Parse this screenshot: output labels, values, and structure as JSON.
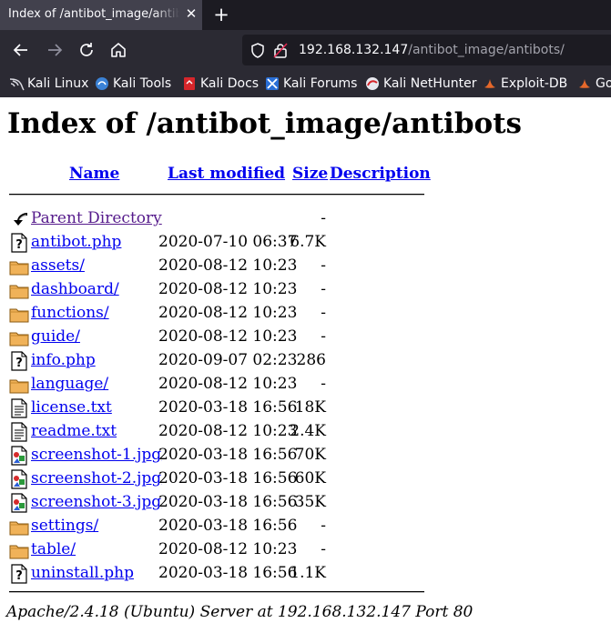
{
  "browser": {
    "tab_title": "Index of /antibot_image/antibots/",
    "close_glyph": "✕",
    "new_tab_glyph": "+",
    "url_host": "192.168.132.147",
    "url_path": "/antibot_image/antibots/"
  },
  "bookmarks": [
    {
      "label": "Kali Linux",
      "icon": "kali-dragon-icon"
    },
    {
      "label": "Kali Tools",
      "icon": "kali-tools-icon"
    },
    {
      "label": "Kali Docs",
      "icon": "kali-docs-icon"
    },
    {
      "label": "Kali Forums",
      "icon": "kali-forums-icon"
    },
    {
      "label": "Kali NetHunter",
      "icon": "kali-nethunter-icon"
    },
    {
      "label": "Exploit-DB",
      "icon": "exploit-db-icon"
    },
    {
      "label": "Go",
      "icon": "ghdb-icon"
    }
  ],
  "page": {
    "title": "Index of /antibot_image/antibots",
    "columns": {
      "name": "Name",
      "last_modified": "Last modified",
      "size": "Size",
      "description": "Description"
    },
    "entries": [
      {
        "name": "Parent Directory",
        "modified": "",
        "size": "-",
        "icon": "back-icon",
        "visited": true
      },
      {
        "name": "antibot.php",
        "modified": "2020-07-10 06:37",
        "size": "6.7K",
        "icon": "unknown-file-icon"
      },
      {
        "name": "assets/",
        "modified": "2020-08-12 10:23",
        "size": "-",
        "icon": "folder-icon"
      },
      {
        "name": "dashboard/",
        "modified": "2020-08-12 10:23",
        "size": "-",
        "icon": "folder-icon"
      },
      {
        "name": "functions/",
        "modified": "2020-08-12 10:23",
        "size": "-",
        "icon": "folder-icon"
      },
      {
        "name": "guide/",
        "modified": "2020-08-12 10:23",
        "size": "-",
        "icon": "folder-icon"
      },
      {
        "name": "info.php",
        "modified": "2020-09-07 02:23",
        "size": "286",
        "icon": "unknown-file-icon"
      },
      {
        "name": "language/",
        "modified": "2020-08-12 10:23",
        "size": "-",
        "icon": "folder-icon"
      },
      {
        "name": "license.txt",
        "modified": "2020-03-18 16:56",
        "size": "18K",
        "icon": "text-file-icon"
      },
      {
        "name": "readme.txt",
        "modified": "2020-08-12 10:23",
        "size": "2.4K",
        "icon": "text-file-icon"
      },
      {
        "name": "screenshot-1.jpg",
        "modified": "2020-03-18 16:56",
        "size": "70K",
        "icon": "image-file-icon"
      },
      {
        "name": "screenshot-2.jpg",
        "modified": "2020-03-18 16:56",
        "size": "60K",
        "icon": "image-file-icon"
      },
      {
        "name": "screenshot-3.jpg",
        "modified": "2020-03-18 16:56",
        "size": "35K",
        "icon": "image-file-icon"
      },
      {
        "name": "settings/",
        "modified": "2020-03-18 16:56",
        "size": "-",
        "icon": "folder-icon"
      },
      {
        "name": "table/",
        "modified": "2020-08-12 10:23",
        "size": "-",
        "icon": "folder-icon"
      },
      {
        "name": "uninstall.php",
        "modified": "2020-03-18 16:56",
        "size": "1.1K",
        "icon": "unknown-file-icon"
      }
    ],
    "footer": "Apache/2.4.18 (Ubuntu) Server at 192.168.132.147 Port 80"
  }
}
